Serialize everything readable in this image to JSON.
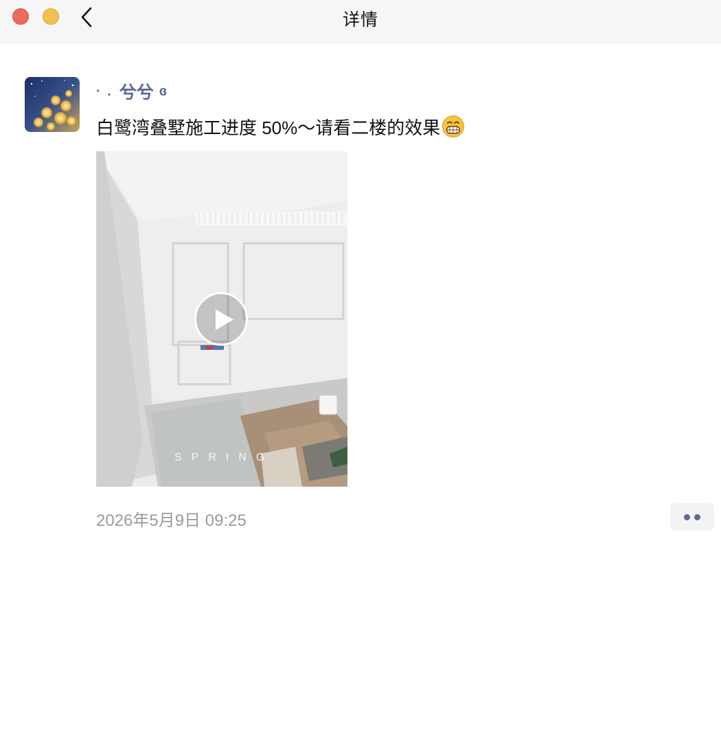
{
  "window": {
    "title": "详情"
  },
  "post": {
    "author": {
      "prefix": "· .",
      "name": "兮兮",
      "suffix": "ɞ"
    },
    "text": "白鹭湾叠墅施工进度 50%～请看二楼的效果",
    "emoji": "grinning-face-emoji",
    "video": {
      "watermark": "SPRING"
    },
    "timestamp": "2026年5月9日 09:25"
  },
  "colors": {
    "accent_name": "#5b6a91",
    "close": "#ec6a5e",
    "minimize": "#f5bf4f",
    "titlebar_bg": "#f6f6f6",
    "timestamp": "#9a9a9a"
  },
  "icons": {
    "back": "chevron-left-icon",
    "play": "play-icon",
    "more": "more-dots-icon"
  }
}
